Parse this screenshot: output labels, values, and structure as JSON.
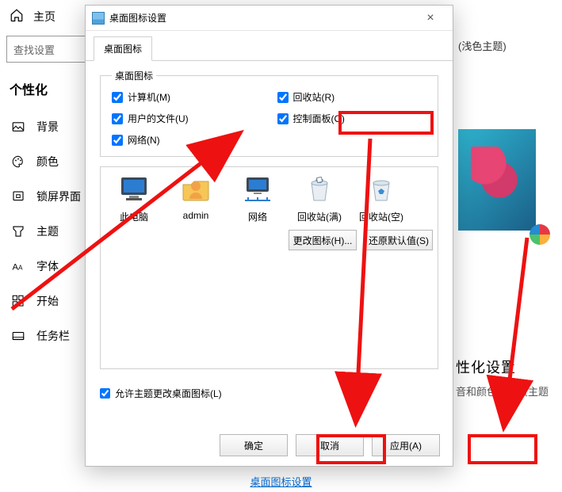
{
  "settings": {
    "home": "主页",
    "search_placeholder": "查找设置",
    "category": "个性化",
    "items": [
      "背景",
      "颜色",
      "锁屏界面",
      "主题",
      "字体",
      "开始",
      "任务栏"
    ],
    "right_theme": "(浅色主题)",
    "more_title": "性化设置",
    "more_sub": "音和颜色的免费主题"
  },
  "dialog": {
    "title": "桌面图标设置",
    "tab": "桌面图标",
    "group_legend": "桌面图标",
    "checks": [
      {
        "label": "计算机(M)",
        "checked": true
      },
      {
        "label": "回收站(R)",
        "checked": true
      },
      {
        "label": "用户的文件(U)",
        "checked": true
      },
      {
        "label": "控制面板(O)",
        "checked": true
      },
      {
        "label": "网络(N)",
        "checked": true
      }
    ],
    "icons": [
      "此电脑",
      "admin",
      "网络",
      "回收站(满)",
      "回收站(空)"
    ],
    "change_icon": "更改图标(H)...",
    "restore_default": "还原默认值(S)",
    "allow_theme": "允许主题更改桌面图标(L)",
    "ok": "确定",
    "cancel": "取消",
    "apply": "应用(A)"
  },
  "link_text": "桌面图标设置"
}
